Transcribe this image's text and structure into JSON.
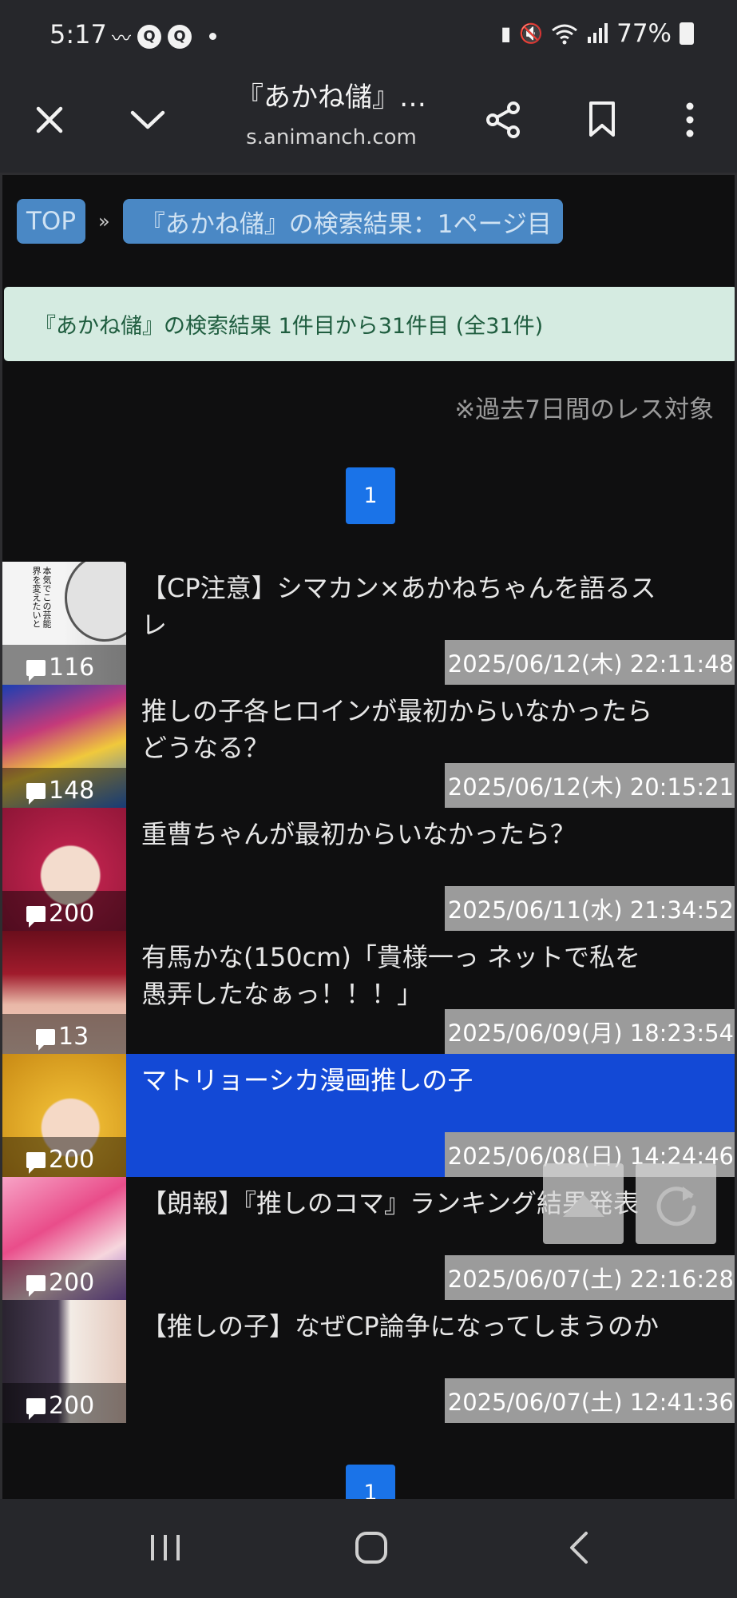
{
  "status_bar": {
    "time": "5:17",
    "battery": "77%",
    "icons": [
      "signal-wave-icon",
      "search-app-icon",
      "search-app-icon",
      "notification-dot-icon",
      "battery-saver-icon",
      "mute-icon",
      "wifi-icon",
      "cell-signal-icon",
      "battery-icon"
    ]
  },
  "browser": {
    "title": "『あかね儲』…",
    "url": "s.animanch.com"
  },
  "breadcrumb": {
    "top": "TOP",
    "separator": "»",
    "current": "『あかね儲』の検索結果：1ページ目"
  },
  "result_summary": "『あかね儲』の検索結果 1件目から31件目 (全31件)",
  "note": "※過去7日間のレス対象",
  "pager": {
    "page": "1"
  },
  "threads": [
    {
      "title": "【CP注意】シマカン×あかねちゃんを語るスレ",
      "count": "116",
      "date": "2025/06/12(木) 22:11:48",
      "thumb_text": "本気でこの芸能界を変えたいと",
      "selected": false
    },
    {
      "title": "推しの子各ヒロインが最初からいなかったらどうなる？",
      "count": "148",
      "date": "2025/06/12(木) 20:15:21",
      "selected": false
    },
    {
      "title": "重曹ちゃんが最初からいなかったら？",
      "count": "200",
      "date": "2025/06/11(水) 21:34:52",
      "selected": false
    },
    {
      "title": "有馬かな(150cm)「貴様一っ ネットで私を愚弄したなぁっ！！！」",
      "count": "13",
      "date": "2025/06/09(月) 18:23:54",
      "selected": false
    },
    {
      "title": "マトリョーシカ漫画推しの子",
      "count": "200",
      "date": "2025/06/08(日) 14:24:46",
      "selected": true
    },
    {
      "title": "【朗報】『推しのコマ』ランキング結果発表",
      "count": "200",
      "date": "2025/06/07(土) 22:16:28",
      "selected": false
    },
    {
      "title": "【推しの子】なぜCP論争になってしまうのか",
      "count": "200",
      "date": "2025/06/07(土) 12:41:36",
      "selected": false
    }
  ],
  "colors": {
    "accent": "#1a73e8",
    "breadcrumb": "#4a88c5",
    "selected_row": "#1349d6",
    "date_badge": "#9b9b9b",
    "result_box": "#d5ebe1"
  }
}
